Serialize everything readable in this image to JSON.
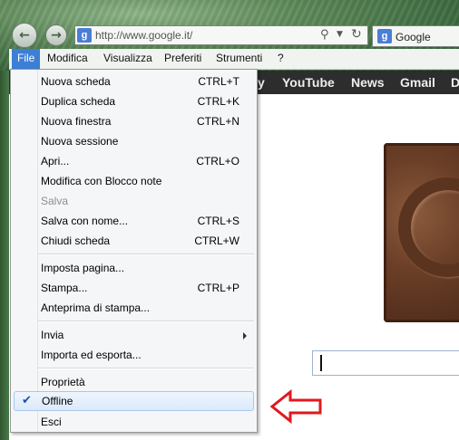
{
  "browser": {
    "address": "http://www.google.it/",
    "tab_title": "Google",
    "favicon_letter": "g"
  },
  "menubar": {
    "items": [
      "File",
      "Modifica",
      "Visualizza",
      "Preferiti",
      "Strumenti",
      "?"
    ]
  },
  "google_bar": {
    "items": [
      "y",
      "YouTube",
      "News",
      "Gmail",
      "D"
    ]
  },
  "file_menu": {
    "items": [
      {
        "label": "Nuova scheda",
        "shortcut": "CTRL+T"
      },
      {
        "label": "Duplica scheda",
        "shortcut": "CTRL+K"
      },
      {
        "label": "Nuova finestra",
        "shortcut": "CTRL+N"
      },
      {
        "label": "Nuova sessione",
        "shortcut": ""
      },
      {
        "label": "Apri...",
        "shortcut": "CTRL+O"
      },
      {
        "label": "Modifica con Blocco note",
        "shortcut": ""
      },
      {
        "label": "Salva",
        "shortcut": "",
        "disabled": true
      },
      {
        "label": "Salva con nome...",
        "shortcut": "CTRL+S"
      },
      {
        "label": "Chiudi scheda",
        "shortcut": "CTRL+W"
      },
      {
        "label": "Imposta pagina...",
        "shortcut": ""
      },
      {
        "label": "Stampa...",
        "shortcut": "CTRL+P"
      },
      {
        "label": "Anteprima di stampa...",
        "shortcut": ""
      },
      {
        "label": "Invia",
        "shortcut": "",
        "submenu": true
      },
      {
        "label": "Importa ed esporta...",
        "shortcut": ""
      },
      {
        "label": "Proprietà",
        "shortcut": ""
      },
      {
        "label": "Offline",
        "shortcut": "",
        "checked": true,
        "highlighted": true
      },
      {
        "label": "Esci",
        "shortcut": ""
      }
    ]
  },
  "colors": {
    "menu_highlight": "#dce9fb",
    "file_active": "#3b7fd6",
    "annotation_arrow": "#e0191d"
  },
  "icons": [
    "back-arrow-icon",
    "forward-arrow-icon",
    "search-icon",
    "refresh-icon",
    "checkmark-icon",
    "submenu-arrow-icon",
    "annotation-arrow-icon"
  ]
}
